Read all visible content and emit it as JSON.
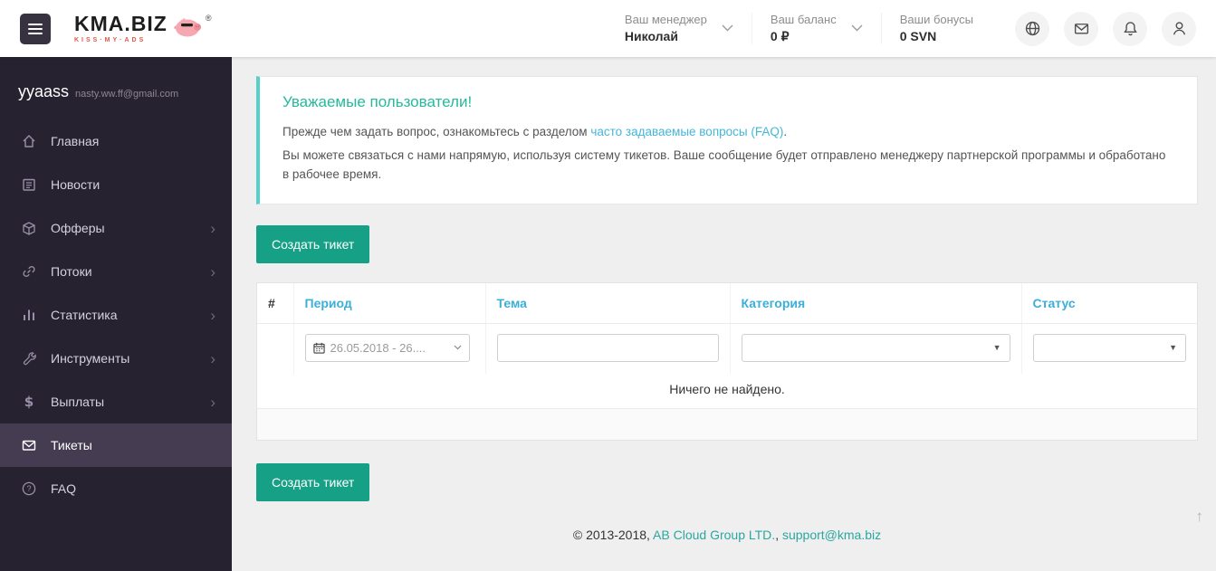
{
  "header": {
    "logo_title": "KMA.BIZ",
    "logo_tagline": "KISS·MY·ADS",
    "logo_reg": "®",
    "manager_label": "Ваш менеджер",
    "manager_value": "Николай",
    "balance_label": "Ваш баланс",
    "balance_value": "0 ₽",
    "bonus_label": "Ваши бонусы",
    "bonus_value": "0 SVN"
  },
  "sidebar": {
    "user_name": "yyaass",
    "user_email": "nasty.ww.ff@gmail.com",
    "items": [
      {
        "label": "Главная",
        "icon": "home-icon"
      },
      {
        "label": "Новости",
        "icon": "news-icon"
      },
      {
        "label": "Офферы",
        "icon": "offers-box-icon"
      },
      {
        "label": "Потоки",
        "icon": "streams-link-icon"
      },
      {
        "label": "Статистика",
        "icon": "statistics-bars-icon"
      },
      {
        "label": "Инструменты",
        "icon": "tools-wrench-icon"
      },
      {
        "label": "Выплаты",
        "icon": "payments-dollar-icon"
      },
      {
        "label": "Тикеты",
        "icon": "tickets-envelope-icon"
      },
      {
        "label": "FAQ",
        "icon": "faq-question-icon"
      }
    ],
    "dollar_glyph": "$",
    "chevron_right_glyph": "›"
  },
  "main": {
    "alert": {
      "title": "Уважаемые пользователи!",
      "line1_prefix": "Прежде чем задать вопрос, ознакомьтесь с разделом ",
      "line1_link": "часто задаваемые вопросы (FAQ)",
      "line1_suffix": ".",
      "line2": "Вы можете связаться с нами напрямую, используя систему тикетов. Ваше сообщение будет отправлено менеджеру партнерской программы и обработано в рабочее время."
    },
    "create_button_label": "Создать тикет",
    "table": {
      "col_number": "#",
      "col_period": "Период",
      "col_topic": "Тема",
      "col_category": "Категория",
      "col_status": "Статус",
      "period_filter_value": "26.05.2018 - 26....",
      "topic_filter_value": "",
      "category_filter_value": "",
      "status_filter_value": "",
      "select_caret_glyph": "▼",
      "empty_text": "Ничего не найдено."
    },
    "footer": {
      "copyright": "© 2013-2018, ",
      "company_link": "AB Cloud Group LTD.",
      "separator": ", ",
      "email_link": "support@kma.biz"
    },
    "scroll_top_glyph": "↑"
  },
  "colors": {
    "accent_green": "#16a085",
    "table_header_blue": "#3bafda",
    "alert_title_teal": "#26b99a",
    "alert_border_cyan": "#56d0cb",
    "footer_link_teal": "#2aa79f",
    "sidebar_bg": "#272230",
    "sidebar_active_bg": "#453c52"
  }
}
